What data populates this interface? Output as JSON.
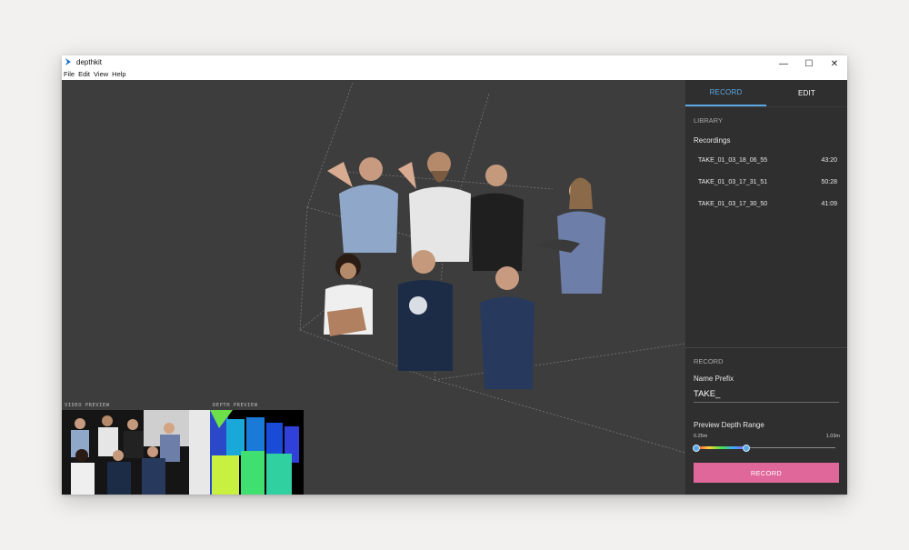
{
  "window": {
    "title": "depthkit",
    "controls": {
      "minimize": "—",
      "maximize": "☐",
      "close": "✕"
    }
  },
  "menu": {
    "items": [
      "File",
      "Edit",
      "View",
      "Help"
    ]
  },
  "viewport": {
    "video_preview_label": "VIDEO PREVIEW",
    "depth_preview_label": "DEPTH PREVIEW"
  },
  "sidebar": {
    "tabs": [
      {
        "label": "RECORD",
        "active": true
      },
      {
        "label": "EDIT",
        "active": false
      }
    ],
    "library": {
      "title": "LIBRARY",
      "recordings_label": "Recordings",
      "recordings": [
        {
          "name": "TAKE_01_03_18_06_55",
          "duration": "43:20"
        },
        {
          "name": "TAKE_01_03_17_31_51",
          "duration": "50:28"
        },
        {
          "name": "TAKE_01_03_17_30_50",
          "duration": "41:09"
        }
      ]
    },
    "record": {
      "title": "RECORD",
      "name_prefix_label": "Name Prefix",
      "name_prefix_value": "TAKE_",
      "depth_range_label": "Preview Depth Range",
      "depth_range_min": "0.25m",
      "depth_range_max": "1.03m",
      "slider_low_fraction": 0.0,
      "slider_high_fraction": 0.36,
      "button_label": "RECORD"
    }
  },
  "colors": {
    "accent": "#5aa9e6",
    "record_button": "#e0679a",
    "sidebar_bg": "#2f2f2f",
    "viewport_bg": "#3d3d3d"
  }
}
